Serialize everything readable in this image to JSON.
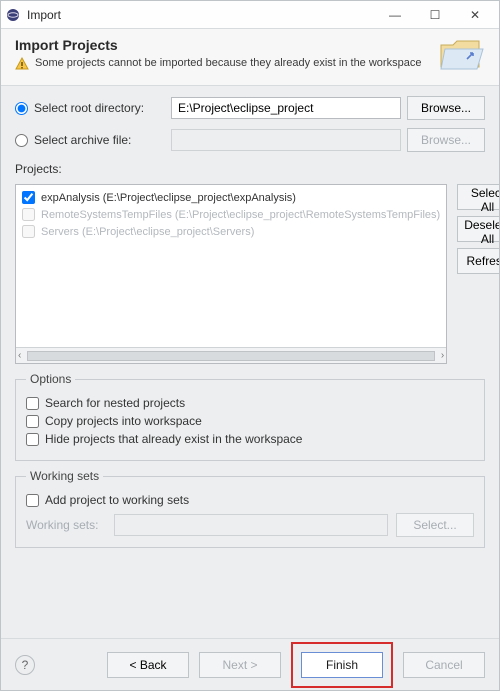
{
  "window": {
    "title": "Import"
  },
  "header": {
    "heading": "Import Projects",
    "warning_msg": "Some projects cannot be imported because they already exist in the workspace"
  },
  "source": {
    "root_dir_label": "Select root directory:",
    "archive_label": "Select archive file:",
    "root_dir_value": "E:\\Project\\eclipse_project",
    "archive_value": "",
    "browse_label": "Browse...",
    "browse_label_disabled": "Browse..."
  },
  "projects": {
    "section_label": "Projects:",
    "items": [
      {
        "label": "expAnalysis (E:\\Project\\eclipse_project\\expAnalysis)",
        "checked": true,
        "enabled": true
      },
      {
        "label": "RemoteSystemsTempFiles (E:\\Project\\eclipse_project\\RemoteSystemsTempFiles)",
        "checked": false,
        "enabled": false
      },
      {
        "label": "Servers (E:\\Project\\eclipse_project\\Servers)",
        "checked": false,
        "enabled": false
      }
    ],
    "buttons": {
      "select_all": "Select All",
      "deselect_all": "Deselect All",
      "refresh": "Refresh"
    }
  },
  "options": {
    "legend": "Options",
    "search_nested": "Search for nested projects",
    "copy_into_ws": "Copy projects into workspace",
    "hide_existing": "Hide projects that already exist in the workspace"
  },
  "working_sets": {
    "legend": "Working sets",
    "add_label": "Add project to working sets",
    "field_label": "Working sets:",
    "select_btn": "Select..."
  },
  "footer": {
    "back": "< Back",
    "next": "Next >",
    "finish": "Finish",
    "cancel": "Cancel"
  }
}
